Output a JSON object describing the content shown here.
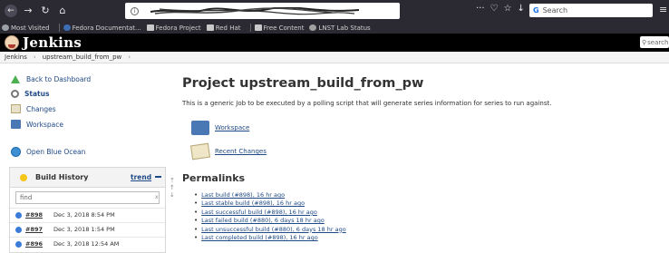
{
  "browser": {
    "url_prefix": "ⓘ",
    "search_placeholder": "Search",
    "bookmarks": [
      "Most Visited",
      "Fedora Documentat...",
      "Fedora Project",
      "Red Hat",
      "Free Content",
      "LNST Lab Status"
    ]
  },
  "jenkins": {
    "title": "Jenkins",
    "search_placeholder": "search"
  },
  "breadcrumb": [
    "Jenkins",
    "upstream_build_from_pw"
  ],
  "tasks": [
    "Back to Dashboard",
    "Status",
    "Changes",
    "Workspace",
    "Open Blue Ocean"
  ],
  "build_history": {
    "title": "Build History",
    "trend": "trend",
    "find_placeholder": "find",
    "clear": "x",
    "builds": [
      {
        "number": "#898",
        "date": "Dec 3, 2018 8:54 PM"
      },
      {
        "number": "#897",
        "date": "Dec 3, 2018 1:54 PM"
      },
      {
        "number": "#896",
        "date": "Dec 3, 2018 12:54 AM"
      }
    ]
  },
  "main": {
    "title": "Project upstream_build_from_pw",
    "description": "This is a generic Job to be executed by a polling script that will generate series information for series to run against.",
    "workspace_link": "Workspace",
    "recent_changes_link": "Recent Changes",
    "permalinks_title": "Permalinks",
    "permalinks": [
      "Last build (#898), 16 hr ago",
      "Last stable build (#898), 16 hr ago",
      "Last successful build (#898), 16 hr ago",
      "Last failed build (#880), 6 days 18 hr ago",
      "Last unsuccessful build (#880), 6 days 18 hr ago",
      "Last completed build (#898), 16 hr ago"
    ]
  },
  "colors": {
    "link": "#204a87",
    "header_bg": "#000000",
    "build_ball": "#3b7bd6"
  }
}
